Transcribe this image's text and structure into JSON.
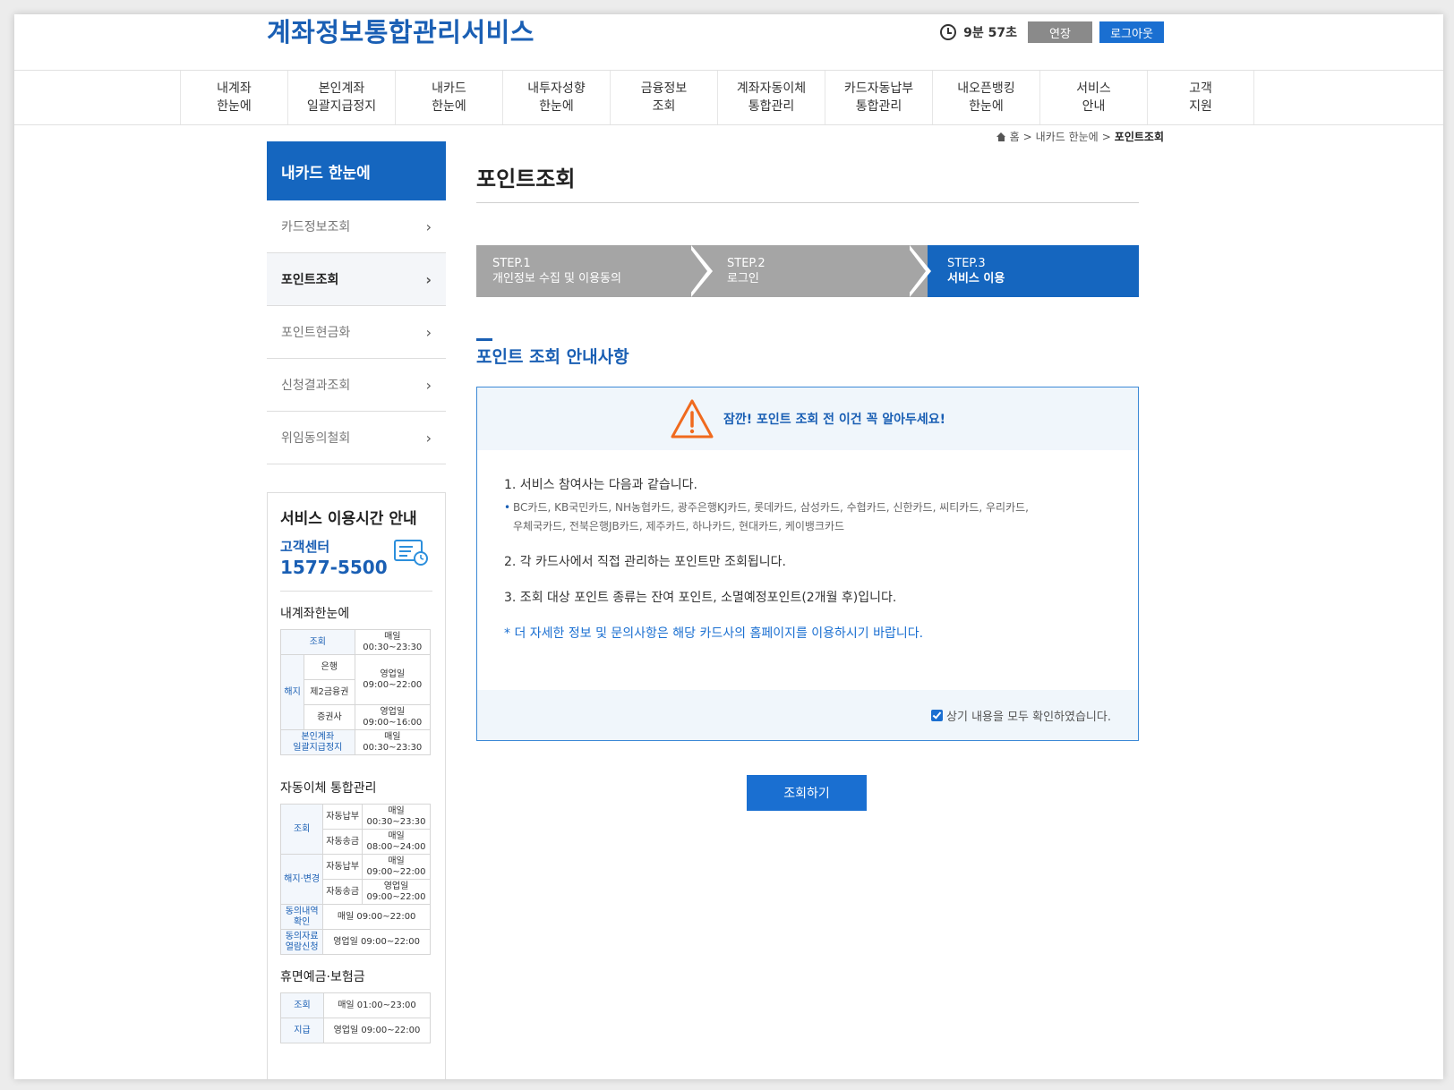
{
  "header": {
    "site_title": "계좌정보통합관리서비스",
    "timer": "9분 57초",
    "extend_label": "연장",
    "logout_label": "로그아웃"
  },
  "gnb": [
    {
      "line1": "내계좌",
      "line2": "한눈에"
    },
    {
      "line1": "본인계좌",
      "line2": "일괄지급정지"
    },
    {
      "line1": "내카드",
      "line2": "한눈에"
    },
    {
      "line1": "내투자성향",
      "line2": "한눈에"
    },
    {
      "line1": "금융정보",
      "line2": "조회"
    },
    {
      "line1": "계좌자동이체",
      "line2": "통합관리"
    },
    {
      "line1": "카드자동납부",
      "line2": "통합관리"
    },
    {
      "line1": "내오픈뱅킹",
      "line2": "한눈에"
    },
    {
      "line1": "서비스",
      "line2": "안내"
    },
    {
      "line1": "고객",
      "line2": "지원"
    }
  ],
  "sidebar": {
    "title": "내카드 한눈에",
    "items": [
      {
        "label": "카드정보조회"
      },
      {
        "label": "포인트조회"
      },
      {
        "label": "포인트현금화"
      },
      {
        "label": "신청결과조회"
      },
      {
        "label": "위임동의철회"
      }
    ],
    "service": {
      "title": "서비스 이용시간 안내",
      "cs_label": "고객센터",
      "cs_phone": "1577-5500",
      "sec1": {
        "title": "내계좌한눈에",
        "query": "조회",
        "query_time1": "매일",
        "query_time2": "00:30~23:30",
        "cancel": "해지",
        "bank": "은행",
        "fin2": "제2금융권",
        "bank_time1": "영업일",
        "bank_time2": "09:00~22:00",
        "sec": "증권사",
        "sec_time1": "영업일",
        "sec_time2": "09:00~16:00",
        "stop1": "본인계좌",
        "stop2": "일괄지급정지",
        "stop_time1": "매일",
        "stop_time2": "00:30~23:30"
      },
      "sec2": {
        "title": "자동이체 통합관리",
        "query": "조회",
        "auto_pay": "자동납부",
        "auto_send": "자동송금",
        "q_pay1": "매일",
        "q_pay2": "00:30~23:30",
        "q_send1": "매일",
        "q_send2": "08:00~24:00",
        "change": "해지·변경",
        "c_pay1": "매일",
        "c_pay2": "09:00~22:00",
        "c_send1": "영업일",
        "c_send2": "09:00~22:00",
        "consent1": "동의내역",
        "consent2": "확인",
        "consent_time": "매일 09:00~22:00",
        "view1": "동의자료",
        "view2": "열람신청",
        "view_time": "영업일 09:00~22:00"
      },
      "sec3": {
        "title": "휴면예금·보험금",
        "query": "조회",
        "query_time": "매일 01:00~23:00",
        "pay": "지급",
        "pay_time": "영업일 09:00~22:00"
      }
    }
  },
  "breadcrumb": {
    "home": "홈",
    "sep": ">",
    "level1": "내카드 한눈에",
    "current": "포인트조회"
  },
  "page_title": "포인트조회",
  "steps": [
    {
      "num": "STEP.1",
      "label": "개인정보 수집 및 이용동의"
    },
    {
      "num": "STEP.2",
      "label": "로그인"
    },
    {
      "num": "STEP.3",
      "label": "서비스 이용"
    }
  ],
  "colors": {
    "step_inactive": "#a5a5a5",
    "step_active": "#1566bf",
    "brand": "#1a5fb4",
    "warning": "#f06a1e"
  },
  "notice": {
    "section_title": "포인트 조회 안내사항",
    "warning": "잠깐! 포인트 조회 전 이건 꼭 알아두세요!",
    "item1": "1. 서비스 참여사는 다음과 같습니다.",
    "item1_sub1": "BC카드, KB국민카드, NH농협카드, 광주은행KJ카드, 롯데카드, 삼성카드, 수협카드, 신한카드, 씨티카드, 우리카드,",
    "item1_sub2": "우체국카드, 전북은행JB카드, 제주카드, 하나카드, 현대카드, 케이뱅크카드",
    "item2": "2. 각 카드사에서 직접 관리하는 포인트만 조회됩니다.",
    "item3": "3. 조회 대상 포인트 종류는 잔여 포인트, 소멸예정포인트(2개월 후)입니다.",
    "note": "* 더 자세한 정보 및 문의사항은 해당 카드사의 홈페이지를 이용하시기 바랍니다.",
    "confirm": "상기 내용을 모두 확인하였습니다."
  },
  "query_button": "조회하기"
}
